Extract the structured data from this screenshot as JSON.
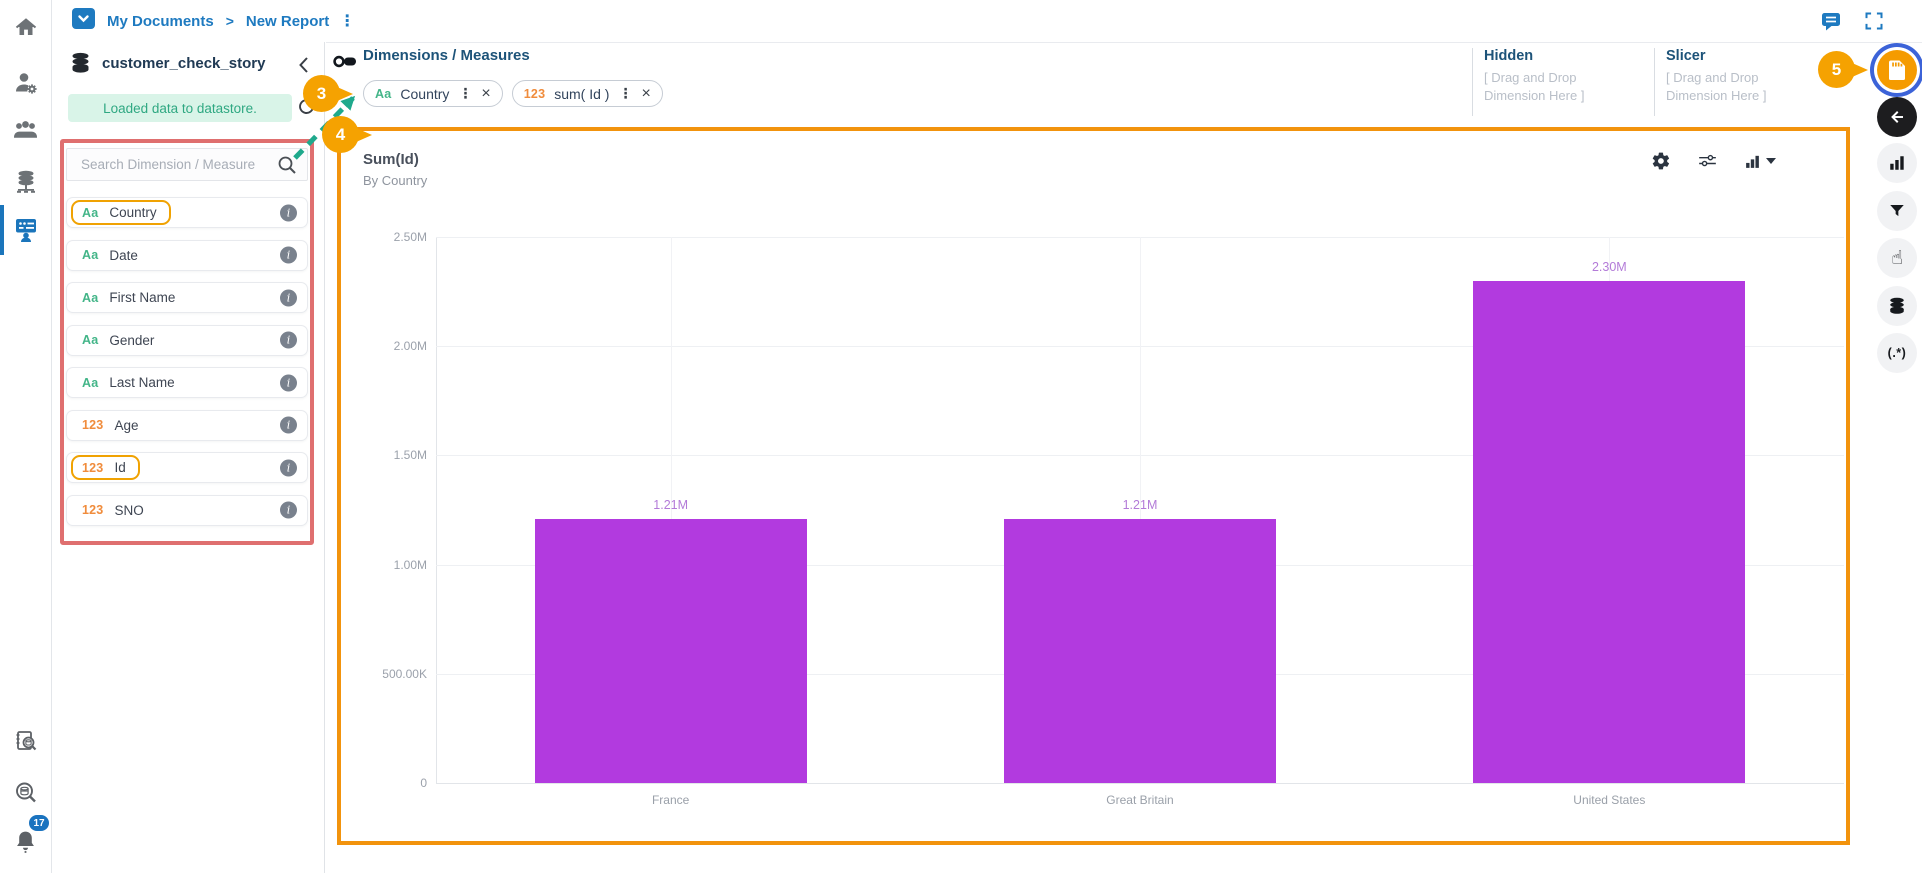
{
  "colors": {
    "accent_blue": "#1E7AC0",
    "navy_header": "#1D5379",
    "dimension_green": "#43B588",
    "measure_orange": "#F08C3C",
    "toast_bg": "#D9F4E8",
    "toast_text": "#2FA882",
    "bar_purple": "#B23ADF",
    "value_label_purple": "#B37BD8",
    "annotation_orange": "#F5A201",
    "chart_border_orange": "#F2930D",
    "annotation_red": "#DF6F6F",
    "arrow_teal": "#1FA98C",
    "highlight_ring_blue": "#3C63D8",
    "active_rail_blue": "#1B75BB"
  },
  "glyphs": {
    "kebab": "⋮",
    "close": "×",
    "chevron_left": "<",
    "separator": ">",
    "hand": "☝",
    "regex": "(.*)",
    "info": "i"
  },
  "topbar": {
    "breadcrumb_root": "My Documents",
    "breadcrumb_current": "New Report",
    "icons": [
      "folder-dropdown",
      "comments",
      "fullscreen"
    ]
  },
  "left_rail": {
    "items": [
      {
        "icon": "home"
      },
      {
        "icon": "user-settings"
      },
      {
        "icon": "user-groups"
      },
      {
        "icon": "data-sources"
      },
      {
        "icon": "story-builder",
        "active": true
      },
      {
        "icon": "report-audit"
      },
      {
        "icon": "metadata-search"
      },
      {
        "icon": "notifications",
        "badge": "17"
      }
    ]
  },
  "datasource_panel": {
    "title": "customer_check_story",
    "toast_message": "Loaded data to datastore.",
    "search_placeholder": "Search Dimension / Measure",
    "fields": [
      {
        "prefix": "Aa",
        "label": "Country",
        "type": "dimension",
        "highlighted": true
      },
      {
        "prefix": "Aa",
        "label": "Date",
        "type": "dimension"
      },
      {
        "prefix": "Aa",
        "label": "First Name",
        "type": "dimension"
      },
      {
        "prefix": "Aa",
        "label": "Gender",
        "type": "dimension"
      },
      {
        "prefix": "Aa",
        "label": "Last Name",
        "type": "dimension"
      },
      {
        "prefix": "123",
        "label": "Age",
        "type": "measure"
      },
      {
        "prefix": "123",
        "label": "Id",
        "type": "measure",
        "highlighted": true
      },
      {
        "prefix": "123",
        "label": "SNO",
        "type": "measure"
      }
    ]
  },
  "canvas_header": {
    "section_title": "Dimensions / Measures",
    "chips": [
      {
        "prefix": "Aa",
        "label": "Country",
        "type": "dimension"
      },
      {
        "prefix": "123",
        "label": "sum( Id )",
        "type": "measure"
      }
    ],
    "hidden_zone": {
      "title": "Hidden",
      "hint": "[ Drag and Drop Dimension Here ]"
    },
    "slicer_zone": {
      "title": "Slicer",
      "hint": "[ Drag and Drop Dimension Here ]"
    }
  },
  "chart_data": {
    "type": "bar",
    "title": "Sum(Id)",
    "subtitle": "By Country",
    "categories": [
      "France",
      "Great Britain",
      "United States"
    ],
    "values": [
      1210000,
      1210000,
      2300000
    ],
    "value_labels": [
      "1.21M",
      "1.21M",
      "2.30M"
    ],
    "ylim": [
      0,
      2500000
    ],
    "yticks": [
      "2.50M",
      "2.00M",
      "1.50M",
      "1.00M",
      "500.00K",
      "0"
    ],
    "xlabel": "",
    "ylabel": "",
    "grid": true,
    "legend": false,
    "bar_color": "#B23ADF",
    "toolbar_icons": [
      "settings",
      "display-options",
      "chart-type-selector"
    ]
  },
  "right_rail": {
    "items": [
      {
        "icon": "save-report",
        "highlighted": true
      },
      {
        "icon": "back"
      },
      {
        "icon": "chart-type"
      },
      {
        "icon": "filter"
      },
      {
        "icon": "interaction-hand"
      },
      {
        "icon": "datastore"
      },
      {
        "icon": "regex"
      }
    ]
  },
  "annotations": {
    "step_3": "3",
    "step_4": "4",
    "step_5": "5"
  }
}
